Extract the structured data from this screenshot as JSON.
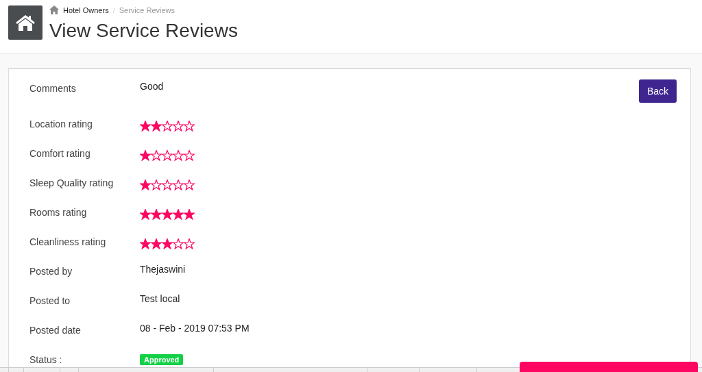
{
  "breadcrumb": [
    {
      "label": "Hotel Owners",
      "selected": false
    },
    {
      "label": "Service Reviews",
      "selected": true
    }
  ],
  "breadcrumb_separator": "/",
  "page_title": "View Service Reviews",
  "back_button": "Back",
  "fields": [
    {
      "kind": "text",
      "label": "Comments",
      "value": "Good"
    },
    {
      "kind": "stars",
      "label": "Location rating",
      "stars": 2
    },
    {
      "kind": "stars",
      "label": "Comfort rating",
      "stars": 1
    },
    {
      "kind": "stars",
      "label": "Sleep Quality rating",
      "stars": 1
    },
    {
      "kind": "stars",
      "label": "Rooms rating",
      "stars": 5
    },
    {
      "kind": "stars",
      "label": "Cleanliness rating",
      "stars": 3
    },
    {
      "kind": "text",
      "label": "Posted by",
      "value": "Thejaswini"
    },
    {
      "kind": "text",
      "label": "Posted to",
      "value": "Test local"
    },
    {
      "kind": "text",
      "label": "Posted date",
      "value": "08 - Feb - 2019 07:53 PM"
    },
    {
      "kind": "badge",
      "label": "Status :",
      "value": "Approved"
    }
  ]
}
